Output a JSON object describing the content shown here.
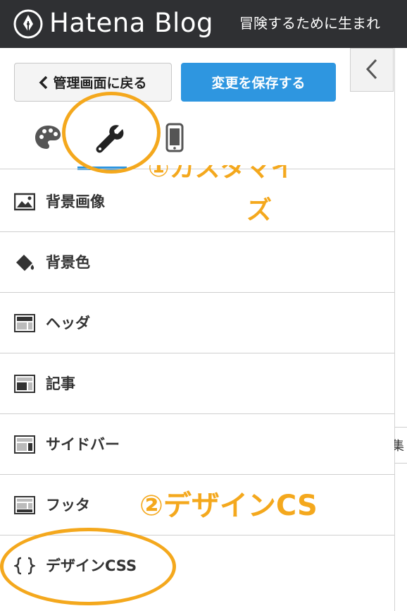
{
  "header": {
    "brand": "Hatena Blog",
    "blog_title": "冒険するために生まれ"
  },
  "toolbar": {
    "back_label": "管理画面に戻る",
    "save_label": "変更を保存する"
  },
  "tabs": [
    {
      "name": "design",
      "icon": "palette-icon"
    },
    {
      "name": "customize",
      "icon": "wrench-icon",
      "active": true
    },
    {
      "name": "smartphone",
      "icon": "smartphone-icon"
    }
  ],
  "menu": {
    "items": [
      {
        "label": "背景画像",
        "icon": "image-icon"
      },
      {
        "label": "背景色",
        "icon": "paint-bucket-icon"
      },
      {
        "label": "ヘッダ",
        "icon": "layout-header-icon"
      },
      {
        "label": "記事",
        "icon": "layout-article-icon"
      },
      {
        "label": "サイドバー",
        "icon": "layout-sidebar-icon"
      },
      {
        "label": "フッタ",
        "icon": "layout-footer-icon"
      },
      {
        "label": "デザインCSS",
        "icon": "braces-icon"
      }
    ]
  },
  "annotations": {
    "step1_line1": "①カスタマイ",
    "step1_line2": "ズ",
    "step2": "②デザインCS"
  },
  "side_strip_char": "集",
  "colors": {
    "header_bg": "#2f3033",
    "accent_blue": "#2e96e0",
    "annotation_orange": "#f4a81d"
  }
}
